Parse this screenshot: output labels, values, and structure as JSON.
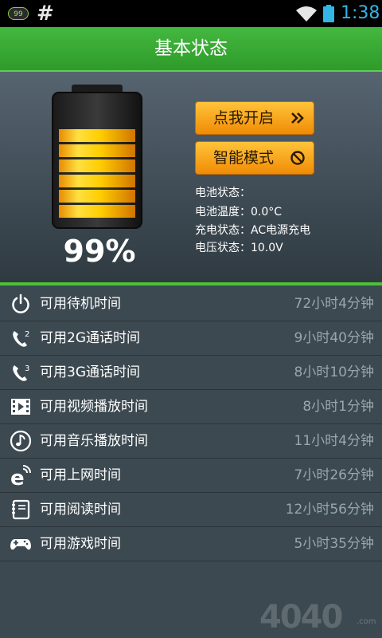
{
  "status_bar": {
    "badge": "99",
    "hash": "#",
    "time": "1:38",
    "icons": [
      "wifi-icon",
      "battery-icon"
    ]
  },
  "header": {
    "title": "基本状态"
  },
  "battery": {
    "percent_text": "99%",
    "level": 0.99
  },
  "buttons": {
    "on_label": "点我开启",
    "on_icon": "double-chevron-right-icon",
    "smart_label": "智能模式",
    "smart_icon": "prohibited-icon"
  },
  "info": [
    "电池状态：",
    "电池温度：0.0°C",
    "充电状态：AC电源充电",
    "电压状态：10.0V"
  ],
  "list": [
    {
      "icon": "power-icon",
      "label": "可用待机时间",
      "value": "72小时4分钟"
    },
    {
      "icon": "phone-2g-icon",
      "label": "可用2G通话时间",
      "value": "9小时40分钟"
    },
    {
      "icon": "phone-3g-icon",
      "label": "可用3G通话时间",
      "value": "8小时10分钟"
    },
    {
      "icon": "video-icon",
      "label": "可用视频播放时间",
      "value": "8小时1分钟"
    },
    {
      "icon": "music-icon",
      "label": "可用音乐播放时间",
      "value": "11小时4分钟"
    },
    {
      "icon": "internet-icon",
      "label": "可用上网时间",
      "value": "7小时26分钟"
    },
    {
      "icon": "book-icon",
      "label": "可用阅读时间",
      "value": "12小时56分钟"
    },
    {
      "icon": "gamepad-icon",
      "label": "可用游戏时间",
      "value": "5小时35分钟"
    }
  ],
  "watermark": {
    "text": "4040",
    "suffix": ".com"
  },
  "colors": {
    "accent_green": "#43b83f",
    "button_orange": "#f9a21f",
    "time_blue": "#33b5e5",
    "battery_yellow": "#ffd400"
  }
}
